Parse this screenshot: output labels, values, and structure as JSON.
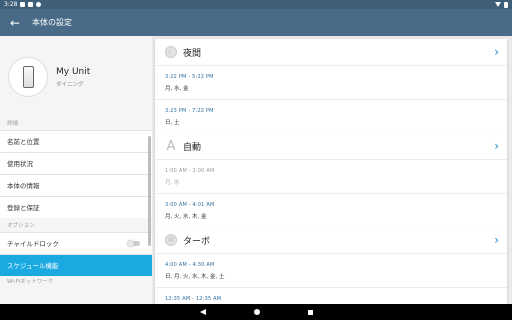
{
  "status": {
    "time": "3:28"
  },
  "appbar": {
    "back_glyph": "←",
    "title": "本体の設定"
  },
  "unit": {
    "name": "My Unit",
    "room": "ダイニング"
  },
  "sections": {
    "details": "詳細",
    "options": "オプション",
    "wifi": "Wi-Fiネットワーク"
  },
  "menu": {
    "items": [
      {
        "label": "名前と位置"
      },
      {
        "label": "使用状況"
      },
      {
        "label": "本体の情報"
      },
      {
        "label": "登録と保証"
      }
    ],
    "child_lock": "チャイルドロック",
    "schedule": "スケジュール機能"
  },
  "cards": [
    {
      "title": "夜間",
      "icon": "moon-icon",
      "entries": [
        {
          "time": "3:22 PM  -  5:22 PM",
          "days": "月, 水, 金"
        },
        {
          "time": "3:23 PM  -  7:22 PM",
          "days": "日, 土"
        }
      ]
    },
    {
      "title": "自動",
      "icon": "auto-a-icon",
      "icon_glyph": "A",
      "entries": [
        {
          "time": "1:00 AM  -  2:00 AM",
          "days": "月, 水"
        },
        {
          "time": "3:00 AM  -  4:01 AM",
          "days": "月, 火, 水, 木, 金"
        }
      ]
    },
    {
      "title": "ターボ",
      "icon": "turbo-icon",
      "entries": [
        {
          "time": "4:00 AM  -  4:30 AM",
          "days": "日, 月, 火, 水, 木, 金, 土"
        },
        {
          "time": "12:35 AM  -  12:35 AM",
          "days": ""
        }
      ]
    }
  ],
  "colors": {
    "appbar": "#4a6b87",
    "status": "#3f5f79",
    "accent": "#1aa9e0",
    "time_text": "#2f6f9f",
    "chevron": "#1a8bc6"
  }
}
